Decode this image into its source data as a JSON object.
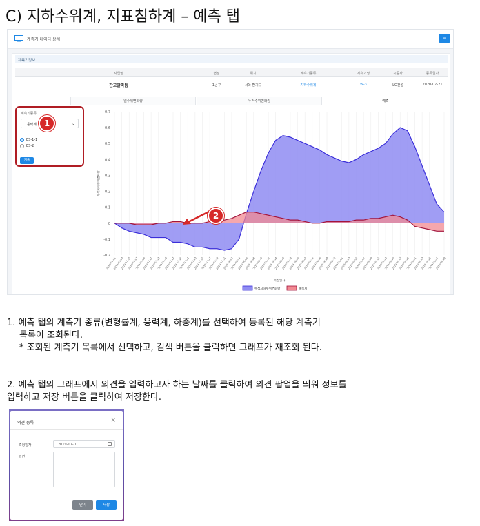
{
  "heading": "C) 지하수위계, 지표침하계 – 예측 탭",
  "screen": {
    "title": "계측기 데이터 상세",
    "menu_icon": "list-icon",
    "section_title": "계측기정보",
    "info": {
      "headers": [
        "사업명",
        "현장",
        "위치",
        "계측기종류",
        "계측기명",
        "시공사",
        "등록일자"
      ],
      "values": [
        "판교알파돔",
        "1공구",
        "서쪽 환기구",
        "지하수위계",
        "W-3",
        "LG건설",
        "2020-07-21"
      ]
    },
    "tabs": [
      {
        "label": "일수위변화량"
      },
      {
        "label": "누적수위변화량"
      },
      {
        "label": "예측"
      }
    ],
    "sidebar": {
      "label": "계측기종류",
      "select_value": "응력계",
      "radios": [
        {
          "label": "ES-1-1",
          "checked": true
        },
        {
          "label": "ES-2",
          "checked": false
        }
      ],
      "search_label": "계출"
    },
    "badges": [
      "1",
      "2"
    ]
  },
  "chart_data": {
    "type": "area",
    "ylabel": "누적지하수위변화량",
    "xlabel": "측정일자",
    "ylim": [
      -0.2,
      0.7
    ],
    "yticks": [
      0.7,
      0.6,
      0.5,
      0.4,
      0.3,
      0.2,
      0.1,
      0,
      -0.1,
      -0.2
    ],
    "x": [
      "2019-07-01",
      "2019-07-03",
      "2019-07-05",
      "2019-07-07",
      "2019-07-09",
      "2019-07-11",
      "2019-07-13",
      "2019-07-15",
      "2019-07-17",
      "2019-07-19",
      "2019-07-21",
      "2019-07-23",
      "2019-07-25",
      "2019-07-27",
      "2019-07-29",
      "2019-07-31",
      "2019-08-02",
      "2019-08-04",
      "2019-08-06",
      "2019-08-08",
      "2019-08-10",
      "2019-08-12",
      "2019-08-14",
      "2019-08-16",
      "2019-08-18",
      "2019-08-20",
      "2019-08-22",
      "2019-08-24",
      "2019-08-26",
      "2019-08-28",
      "2019-08-30",
      "2019-09-01",
      "2019-09-03",
      "2019-09-05",
      "2019-09-07",
      "2019-09-09",
      "2019-09-11",
      "2019-09-13",
      "2019-09-15",
      "2019-09-17",
      "2019-09-19",
      "2019-09-21",
      "2019-09-23",
      "2019-09-25",
      "2019-09-27",
      "2019-09-29"
    ],
    "series": [
      {
        "name": "누적지하수위변화량",
        "color": "#3b2fd9",
        "fill": "#8f8cf2",
        "values": [
          0.0,
          -0.03,
          -0.05,
          -0.06,
          -0.07,
          -0.09,
          -0.09,
          -0.09,
          -0.12,
          -0.12,
          -0.13,
          -0.15,
          -0.15,
          -0.16,
          -0.16,
          -0.17,
          -0.16,
          -0.1,
          0.06,
          0.2,
          0.33,
          0.44,
          0.52,
          0.55,
          0.54,
          0.52,
          0.5,
          0.48,
          0.46,
          0.43,
          0.41,
          0.39,
          0.38,
          0.4,
          0.43,
          0.45,
          0.47,
          0.5,
          0.56,
          0.6,
          0.58,
          0.48,
          0.36,
          0.24,
          0.12,
          0.07
        ]
      },
      {
        "name": "예측치",
        "color": "#a2143c",
        "fill": "#f28a92",
        "values": [
          0.0,
          0.0,
          0.0,
          -0.01,
          -0.01,
          -0.01,
          0.0,
          0.0,
          0.01,
          0.01,
          0.0,
          0.0,
          0.0,
          0.01,
          0.01,
          0.02,
          0.03,
          0.05,
          0.07,
          0.07,
          0.06,
          0.05,
          0.04,
          0.03,
          0.02,
          0.02,
          0.01,
          0.0,
          0.0,
          0.01,
          0.01,
          0.01,
          0.01,
          0.02,
          0.02,
          0.03,
          0.03,
          0.04,
          0.05,
          0.04,
          0.02,
          -0.02,
          -0.03,
          -0.04,
          -0.05,
          -0.05
        ]
      }
    ],
    "legend": "bottom"
  },
  "steps": {
    "line1a": "1. 예측 탭의 계측기 종류(변형률계, 응력계, 하중계)를 선택하여 등록된 해당 계측기",
    "line1b": "목록이 조회된다.",
    "line1c": "* 조회된 계측기 목록에서 선택하고, 검색 버튼을 클릭하면 그래프가 재조회 된다.",
    "line2a": "2. 예측 탭의 그래프에서 의견을 입력하고자 하는 날짜를 클릭하여 의견 팝업을 띄워 정보를",
    "line2b": "입력하고 저장 버튼을 클릭하여 저장한다."
  },
  "popup": {
    "title": "의견 등록",
    "date_label": "측정일자",
    "date_value": "2019-07-01",
    "opinion_label": "의견",
    "close_label": "닫기",
    "save_label": "저장"
  }
}
